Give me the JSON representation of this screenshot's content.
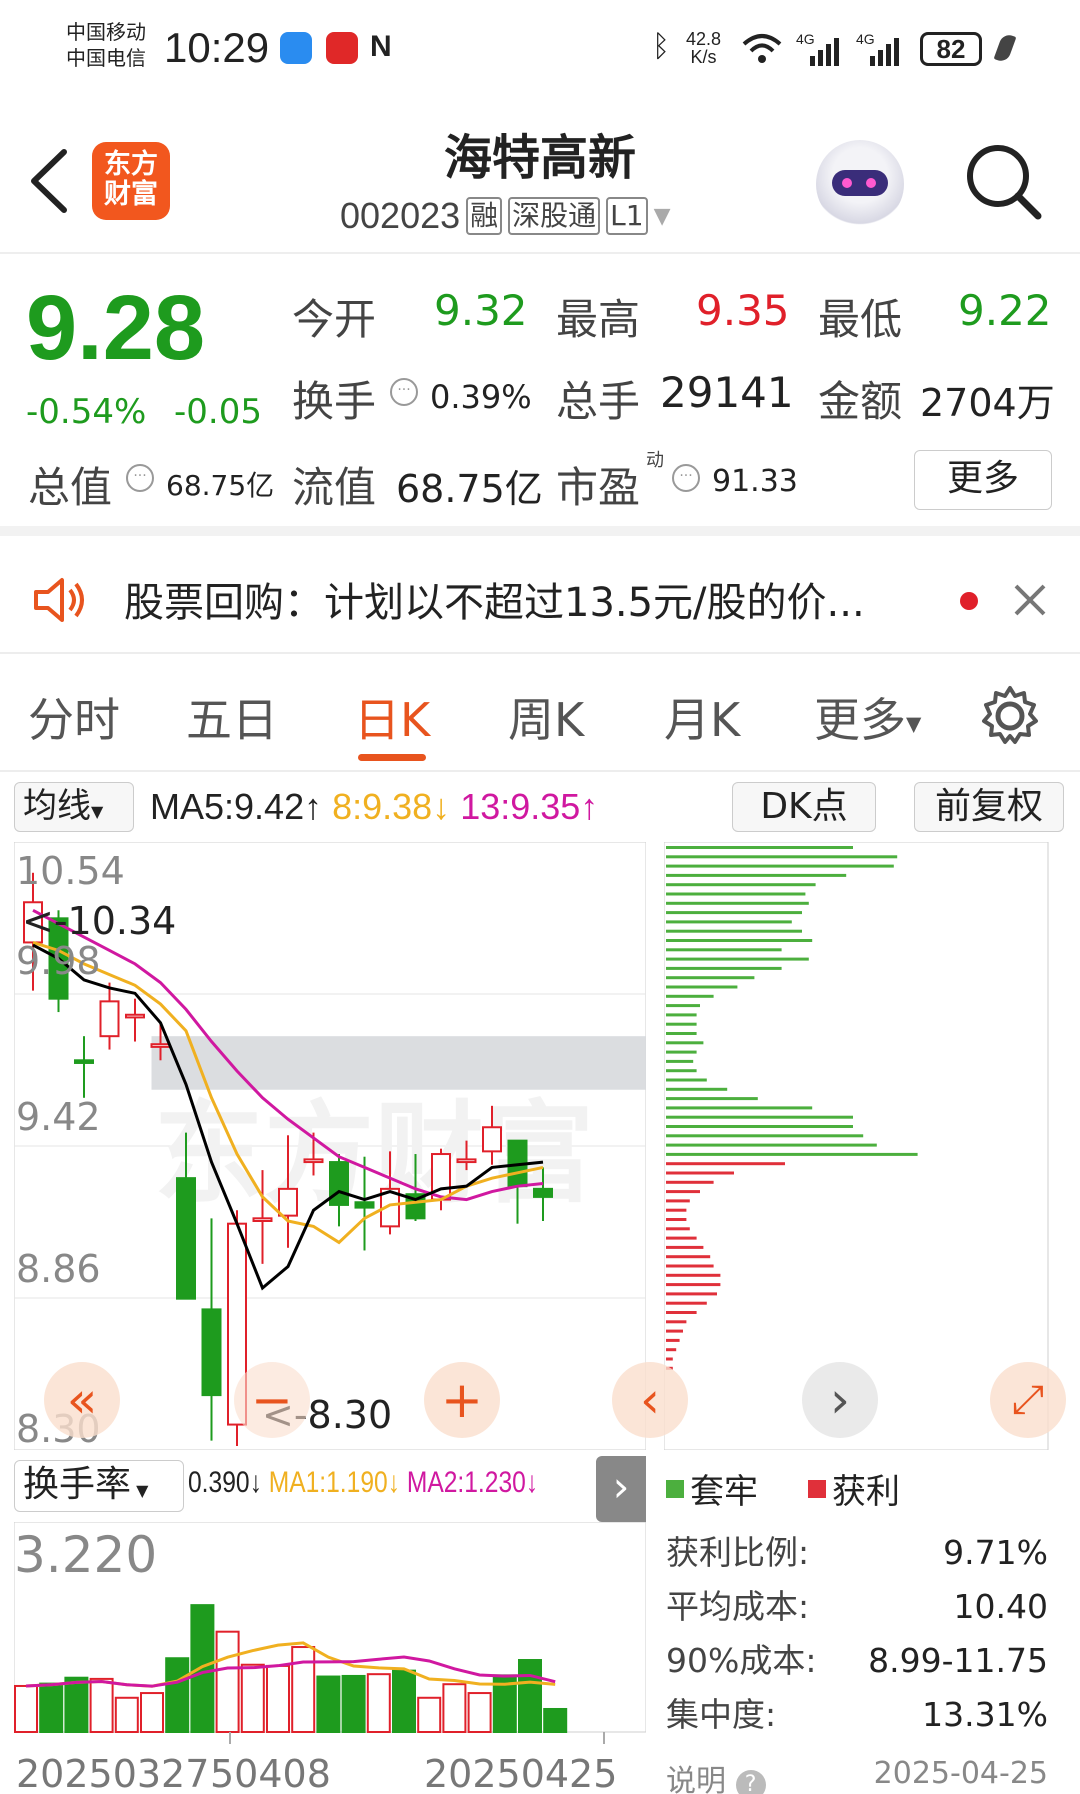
{
  "status_bar": {
    "carrier1": "中国移动",
    "carrier2": "中国电信",
    "time": "10:29",
    "net_speed_value": "42.8",
    "net_speed_unit": "K/s",
    "battery": "82"
  },
  "header": {
    "app_logo_line1": "东方",
    "app_logo_line2": "财富",
    "stock_name": "海特高新",
    "stock_code": "002023",
    "tags": [
      "融",
      "深股通",
      "L1"
    ]
  },
  "quote": {
    "price": "9.28",
    "change_pct": "-0.54%",
    "change": "-0.05",
    "open_label": "今开",
    "open": "9.32",
    "high_label": "最高",
    "high": "9.35",
    "low_label": "最低",
    "low": "9.22",
    "turnover_label": "换手",
    "turnover": "0.39%",
    "volume_label": "总手",
    "volume": "29141",
    "amount_label": "金额",
    "amount": "2704万",
    "market_cap_label": "总值",
    "market_cap": "68.75亿",
    "float_cap_label": "流值",
    "float_cap": "68.75亿",
    "pe_label": "市盈",
    "pe_superscript": "动",
    "pe": "91.33",
    "more_button": "更多"
  },
  "notice": {
    "text": "股票回购：计划以不超过13.5元/股的价..."
  },
  "tabs": [
    {
      "label": "分时",
      "active": false
    },
    {
      "label": "五日",
      "active": false
    },
    {
      "label": "日K",
      "active": true
    },
    {
      "label": "周K",
      "active": false
    },
    {
      "label": "月K",
      "active": false
    },
    {
      "label": "更多",
      "active": false
    }
  ],
  "indicator_bar": {
    "ma_selector": "均线",
    "ma5": "MA5:9.42",
    "ma8": "8:9.38",
    "ma13": "13:9.35",
    "dk_button": "DK点",
    "adjust_button": "前复权"
  },
  "kline": {
    "y_labels": [
      "10.54",
      "9.98",
      "9.42",
      "8.86",
      "8.30"
    ],
    "max_annotation": "<-10.34",
    "min_annotation": "<-8.30",
    "candles": [
      {
        "o": 10.18,
        "c": 10.33,
        "h": 10.44,
        "l": 10.0
      },
      {
        "o": 10.27,
        "c": 9.97,
        "h": 10.3,
        "l": 9.92
      },
      {
        "o": 9.74,
        "c": 9.73,
        "h": 9.83,
        "l": 9.6
      },
      {
        "o": 9.83,
        "c": 9.96,
        "h": 10.03,
        "l": 9.78
      },
      {
        "o": 9.9,
        "c": 9.91,
        "h": 9.97,
        "l": 9.81
      },
      {
        "o": 9.79,
        "c": 9.8,
        "h": 9.88,
        "l": 9.74
      },
      {
        "o": 9.3,
        "c": 8.85,
        "h": 9.47,
        "l": 8.85
      },
      {
        "o": 8.81,
        "c": 8.49,
        "h": 9.15,
        "l": 8.32
      },
      {
        "o": 8.38,
        "c": 9.13,
        "h": 9.18,
        "l": 8.3
      },
      {
        "o": 9.14,
        "c": 9.15,
        "h": 9.33,
        "l": 8.98
      },
      {
        "o": 9.16,
        "c": 9.26,
        "h": 9.46,
        "l": 9.04
      },
      {
        "o": 9.36,
        "c": 9.37,
        "h": 9.47,
        "l": 9.31
      },
      {
        "o": 9.36,
        "c": 9.2,
        "h": 9.39,
        "l": 9.12
      },
      {
        "o": 9.21,
        "c": 9.19,
        "h": 9.38,
        "l": 9.03
      },
      {
        "o": 9.12,
        "c": 9.26,
        "h": 9.4,
        "l": 9.09
      },
      {
        "o": 9.24,
        "c": 9.15,
        "h": 9.39,
        "l": 9.14
      },
      {
        "o": 9.22,
        "c": 9.39,
        "h": 9.41,
        "l": 9.18
      },
      {
        "o": 9.36,
        "c": 9.37,
        "h": 9.44,
        "l": 9.33
      },
      {
        "o": 9.4,
        "c": 9.49,
        "h": 9.57,
        "l": 9.35
      },
      {
        "o": 9.44,
        "c": 9.27,
        "h": 9.44,
        "l": 9.13
      },
      {
        "o": 9.26,
        "c": 9.23,
        "h": 9.34,
        "l": 9.14
      }
    ],
    "ma5": [
      10.17,
      10.12,
      10.04,
      10.01,
      9.99,
      9.88,
      9.65,
      9.36,
      9.13,
      8.89,
      8.97,
      9.18,
      9.25,
      9.22,
      9.25,
      9.22,
      9.26,
      9.27,
      9.34,
      9.35,
      9.36
    ],
    "ma8": [
      10.18,
      10.15,
      10.1,
      10.06,
      10.02,
      9.95,
      9.85,
      9.6,
      9.39,
      9.23,
      9.14,
      9.12,
      9.06,
      9.15,
      9.2,
      9.21,
      9.22,
      9.27,
      9.3,
      9.32,
      9.34
    ],
    "ma13": [
      10.3,
      10.25,
      10.2,
      10.15,
      10.1,
      10.03,
      9.93,
      9.81,
      9.7,
      9.6,
      9.52,
      9.45,
      9.38,
      9.34,
      9.3,
      9.26,
      9.23,
      9.22,
      9.25,
      9.27,
      9.28
    ],
    "resistance_zone": {
      "from": 9.63,
      "to": 9.83,
      "start_index": 5
    }
  },
  "volume_panel": {
    "selector": "换手率",
    "value": "0.390",
    "ma1": "MA1:1.190",
    "ma2": "MA2:1.230",
    "y_label": "3.220",
    "x_labels": [
      "20250327",
      "50408",
      "20250425"
    ],
    "bars": [
      0.78,
      0.82,
      0.92,
      0.9,
      0.58,
      0.66,
      1.25,
      2.15,
      1.7,
      1.14,
      1.12,
      1.44,
      0.94,
      0.95,
      0.98,
      1.04,
      0.58,
      0.81,
      0.66,
      0.96,
      1.22,
      0.39
    ]
  },
  "chip_panel": {
    "legend_trapped": "套牢",
    "legend_profit": "获利",
    "stats": [
      {
        "label": "获利比例:",
        "value": "9.71%"
      },
      {
        "label": "平均成本:",
        "value": "10.40"
      },
      {
        "label": "90%成本:",
        "value": "8.99-11.75"
      },
      {
        "label": "集中度:",
        "value": "13.31%"
      }
    ],
    "footer_label": "说明",
    "footer_date": "2025-04-25",
    "green_bars": [
      0.55,
      0.68,
      0.67,
      0.53,
      0.44,
      0.41,
      0.42,
      0.4,
      0.37,
      0.4,
      0.43,
      0.34,
      0.42,
      0.34,
      0.26,
      0.21,
      0.14,
      0.1,
      0.09,
      0.09,
      0.09,
      0.11,
      0.09,
      0.08,
      0.09,
      0.12,
      0.18,
      0.27,
      0.43,
      0.55,
      0.55,
      0.58,
      0.62,
      0.74
    ],
    "red_bars": [
      0.35,
      0.2,
      0.14,
      0.1,
      0.07,
      0.06,
      0.06,
      0.07,
      0.09,
      0.11,
      0.13,
      0.14,
      0.16,
      0.16,
      0.15,
      0.12,
      0.09,
      0.06,
      0.05,
      0.04,
      0.03,
      0.02,
      0.02
    ]
  },
  "colors": {
    "up": "#e0202a",
    "down": "#1e9b1e",
    "accent": "#e8541e",
    "ma5": "#000000",
    "ma8": "#f0b020",
    "ma13": "#d018a0"
  }
}
